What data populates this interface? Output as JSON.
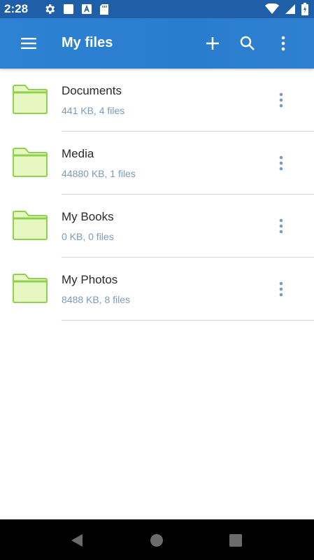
{
  "status_bar": {
    "time": "2:28",
    "icons": [
      "settings-icon",
      "square-notification-icon",
      "font-a-icon",
      "sd-card-icon",
      "wifi-icon",
      "signal-icon",
      "battery-icon"
    ]
  },
  "app_bar": {
    "title": "My files",
    "actions": [
      "add-icon",
      "search-icon",
      "more-vert-icon"
    ],
    "color": "#2d82d4"
  },
  "folders": [
    {
      "name": "Documents",
      "meta": "441 KB, 4 files"
    },
    {
      "name": "Media",
      "meta": "44880 KB, 1 files"
    },
    {
      "name": "My Books",
      "meta": "0 KB, 0 files"
    },
    {
      "name": "My Photos",
      "meta": "8488 KB, 8 files"
    }
  ],
  "colors": {
    "folder_fill": "#e6f7c2",
    "folder_stroke": "#8fd14f",
    "meta_text": "#7a9bbd",
    "statusbar": "#1f5fa8"
  },
  "nav_bar": {
    "icons": [
      "back-icon",
      "home-icon",
      "recents-icon"
    ]
  }
}
